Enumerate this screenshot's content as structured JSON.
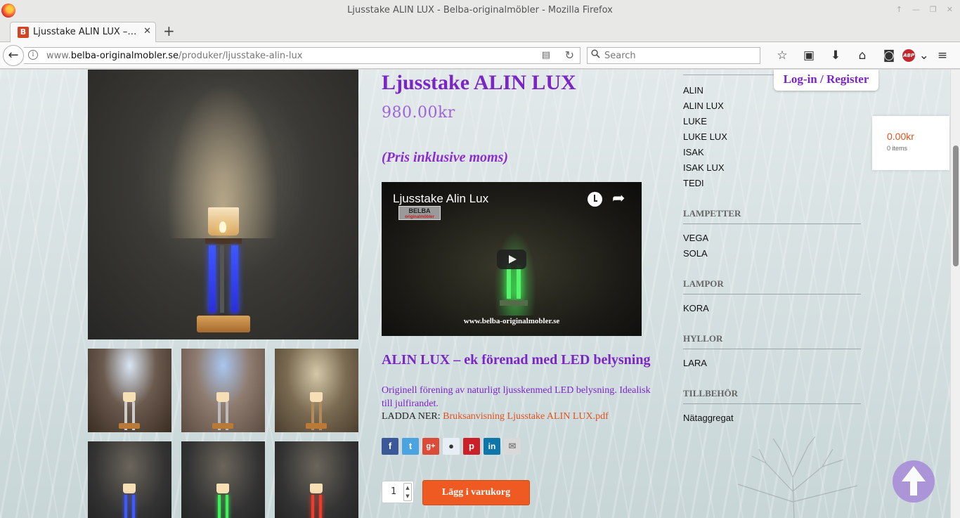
{
  "window": {
    "title": "Ljusstake ALIN LUX - Belba-originalmöbler - Mozilla Firefox"
  },
  "tab": {
    "label": "Ljusstake ALIN LUX –…",
    "close": "✕"
  },
  "newtab": "+",
  "nav": {
    "url_prefix": "www.",
    "url_domain": "belba-originalmobler.se",
    "url_path": "/produker/ljusstake-alin-lux",
    "search_placeholder": "Search",
    "icons": [
      "back-icon",
      "info-icon",
      "reader-view-icon",
      "reload-icon",
      "search-icon",
      "bookmark-star-icon",
      "reading-list-icon",
      "download-icon",
      "home-icon",
      "pocket-icon",
      "adblock-icon",
      "menu-icon"
    ],
    "adblock_label": "ABP"
  },
  "product": {
    "title": "Ljusstake ALIN LUX",
    "price": "980.00kr",
    "vat_note": "(Pris inklusive moms)",
    "subtitle": "ALIN LUX – ek förenad med LED belysning",
    "description": "Originell förening av naturligt ljusskenmed LED belysning. Idealisk till julfirandet.",
    "download_label": "LADDA NER:",
    "download_link": "Bruksanvisning Ljusstake ALIN LUX.pdf",
    "quantity": "1",
    "add_to_cart": "Lägg i varukorg",
    "share_icons": [
      "facebook-icon",
      "twitter-icon",
      "google-plus-icon",
      "reddit-icon",
      "pinterest-icon",
      "linkedin-icon",
      "email-icon"
    ]
  },
  "video": {
    "title": "Ljusstake Alin Lux",
    "logo": "BELBA",
    "logo_sub": "originalmöbler",
    "watermark": "www.belba-originalmobler.se"
  },
  "sidebar": {
    "ljusstakar": [
      "ALIN",
      "ALIN LUX",
      "LUKE",
      "LUKE LUX",
      "ISAK",
      "ISAK LUX",
      "TEDI"
    ],
    "lampetter": {
      "heading": "LAMPETTER",
      "items": [
        "VEGA",
        "SOLA"
      ]
    },
    "lampor": {
      "heading": "LAMPOR",
      "items": [
        "KORA"
      ]
    },
    "hyllor": {
      "heading": "HYLLOR",
      "items": [
        "LARA"
      ]
    },
    "tillbehor": {
      "heading": "TILLBEHÖR",
      "items": [
        "Nätaggregat"
      ]
    }
  },
  "header": {
    "login": "Log-in / Register",
    "cart_total": "0.00kr",
    "cart_items": "0 items"
  },
  "colors": {
    "accent_purple": "#7b25c7",
    "price_purple": "#a064d8",
    "link_orange": "#e0531e",
    "cart_button": "#ef5a23"
  }
}
